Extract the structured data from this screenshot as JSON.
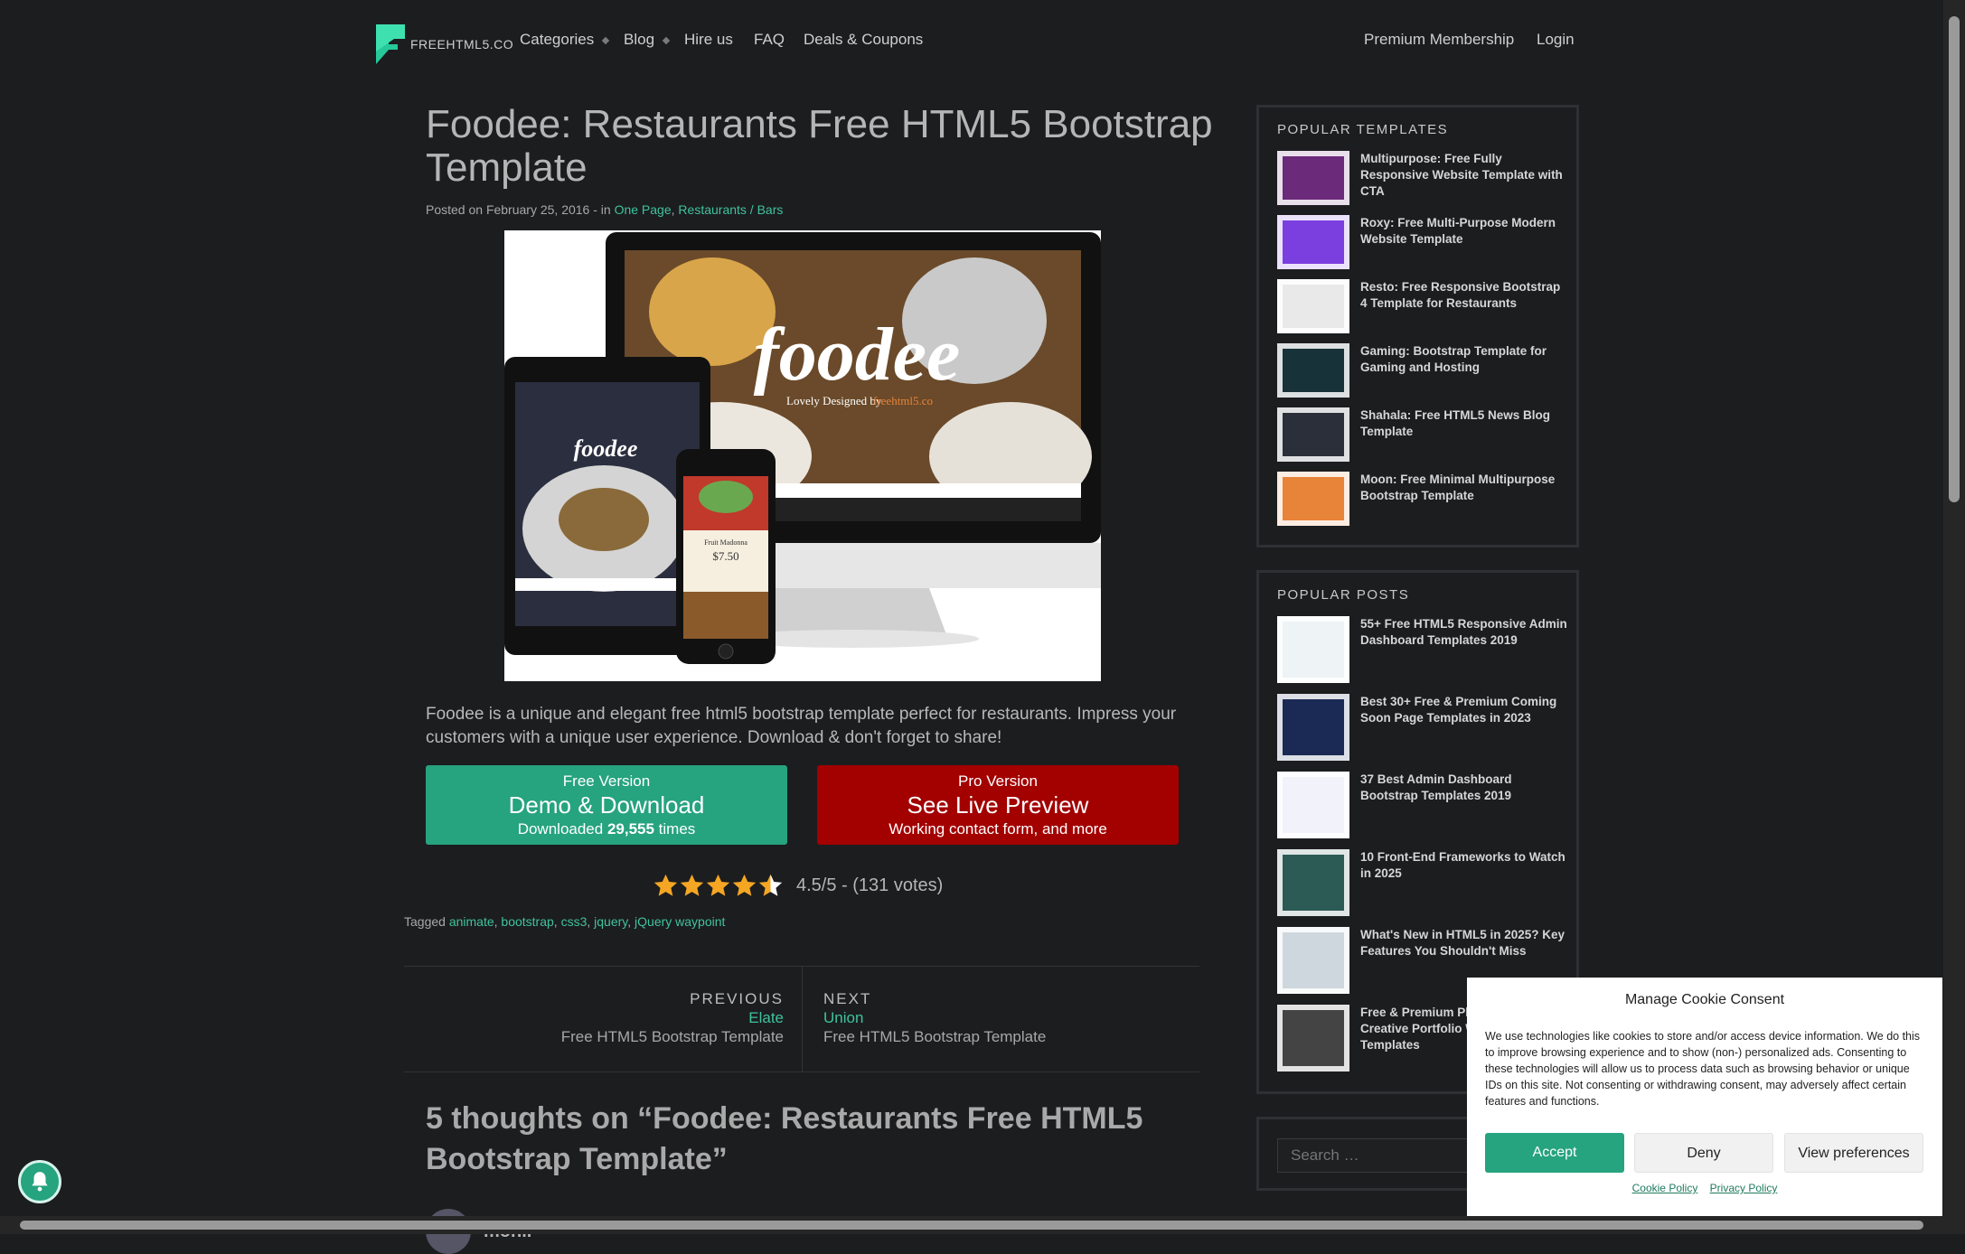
{
  "nav": {
    "logo_text": "FREEHTML5.CO",
    "items": [
      {
        "label": "Categories",
        "has_caret": true
      },
      {
        "label": "Blog",
        "has_caret": true
      },
      {
        "label": "Hire us",
        "has_caret": false
      },
      {
        "label": "FAQ",
        "has_caret": false
      },
      {
        "label": "Deals & Coupons",
        "has_caret": false
      }
    ],
    "right": [
      {
        "label": "Premium Membership"
      },
      {
        "label": "Login"
      }
    ]
  },
  "article": {
    "title": "Foodee: Restaurants Free HTML5 Bootstrap Template",
    "meta_prefix": "Posted on February 25, 2016 - in ",
    "categories": [
      "One Page",
      "Restaurants / Bars"
    ],
    "hero_brand": "foodee",
    "hero_tagline": "Lovely Designed by",
    "hero_tagline_brand": "freehtml5.co",
    "hero_price": "$7.50",
    "hero_dish": "Fruit Madonna",
    "excerpt": "Foodee is a unique and elegant free html5 bootstrap template perfect for restaurants. Impress your customers with a unique user experience. Download & don't forget to share!",
    "free_button": {
      "line1": "Free Version",
      "line2": "Demo & Download",
      "line3_prefix": "Downloaded ",
      "count": "29,555",
      "line3_suffix": " times"
    },
    "pro_button": {
      "line1": "Pro Version",
      "line2": "See Live Preview",
      "line3": "Working contact form, and more"
    },
    "rating": {
      "text": "4.5/5 - (131 votes)",
      "stars": 4.5
    },
    "tagged_label": "Tagged ",
    "tags": [
      "animate",
      "bootstrap",
      "css3",
      "jquery",
      "jQuery waypoint"
    ],
    "prev": {
      "label": "PREVIOUS",
      "title": "Elate",
      "sub": "Free HTML5 Bootstrap Template"
    },
    "next": {
      "label": "NEXT",
      "title": "Union",
      "sub": "Free HTML5 Bootstrap Template"
    },
    "comments_title": "5 thoughts on “Foodee: Restaurants Free HTML5 Bootstrap Template”",
    "first_commenter": "monir"
  },
  "sidebar": {
    "templates_title": "POPULAR TEMPLATES",
    "templates": [
      {
        "title": "Multipurpose: Free Fully Responsive Website Template with CTA",
        "color": "#6b2a7a"
      },
      {
        "title": "Roxy: Free Multi-Purpose Modern Website Template",
        "color": "#7b3fe0"
      },
      {
        "title": "Resto: Free Responsive Bootstrap 4 Template for Restaurants",
        "color": "#e9e9e9"
      },
      {
        "title": "Gaming: Bootstrap Template for Gaming and Hosting",
        "color": "#18323a"
      },
      {
        "title": "Shahala: Free HTML5 News Blog Template",
        "color": "#2a2f3a"
      },
      {
        "title": "Moon: Free Minimal Multipurpose Bootstrap Template",
        "color": "#e8833a"
      }
    ],
    "posts_title": "POPULAR POSTS",
    "posts": [
      {
        "title": "55+ Free HTML5 Responsive Admin Dashboard Templates 2019",
        "color": "#eef3f5"
      },
      {
        "title": "Best 30+ Free & Premium Coming Soon Page Templates in 2023",
        "color": "#1a2a55"
      },
      {
        "title": "37 Best Admin Dashboard Bootstrap Templates 2019",
        "color": "#f2f2fa"
      },
      {
        "title": "10 Front-End Frameworks to Watch in 2025",
        "color": "#2c5a55"
      },
      {
        "title": "What's New in HTML5 in 2025? Key Features You Shouldn't Miss",
        "color": "#cfd7de"
      },
      {
        "title": "Free & Premium Photography Creative Portfolio Website Templates",
        "color": "#444444"
      }
    ],
    "search_placeholder": "Search …"
  },
  "cookie": {
    "title": "Manage Cookie Consent",
    "body": "We use technologies like cookies to store and/or access device information. We do this to improve browsing experience and to show (non-) personalized ads. Consenting to these technologies will allow us to process data such as browsing behavior or unique IDs on this site. Not consenting or withdrawing consent, may adversely affect certain features and functions.",
    "accept": "Accept",
    "deny": "Deny",
    "preferences": "View preferences",
    "links": [
      "Cookie Policy",
      "Privacy Policy"
    ]
  },
  "colors": {
    "accent": "#26a37f",
    "link": "#3fc39a",
    "pro": "#a30000",
    "star": "#f5a623",
    "background": "#1c1d1f"
  }
}
